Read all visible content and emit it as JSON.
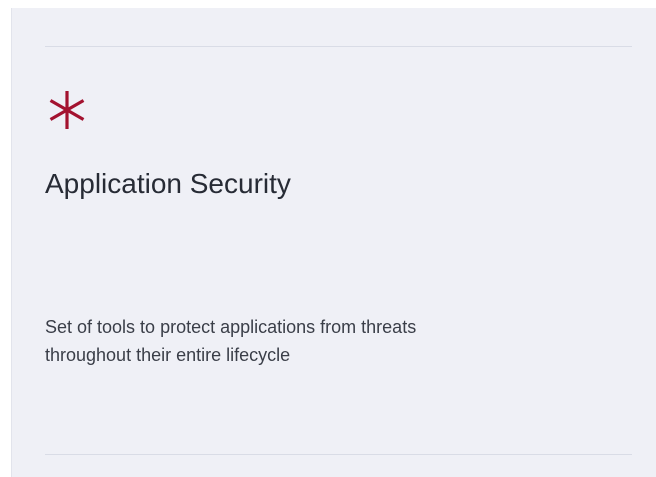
{
  "card": {
    "icon": "asterisk-icon",
    "icon_color": "#a3122f",
    "title": "Application Security",
    "description": "Set of tools to protect applications from threats throughout their entire lifecycle",
    "background_color": "#eff0f6"
  }
}
